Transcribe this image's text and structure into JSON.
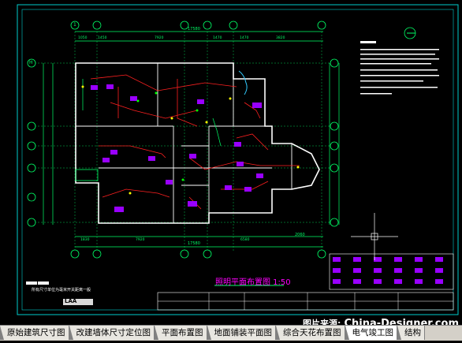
{
  "drawing": {
    "dims_top": [
      "17580"
    ],
    "dims_top_parts": [
      "1050",
      "1450",
      "7920",
      "1470",
      "1470",
      "3820"
    ],
    "dims_bottom": [
      "17580"
    ],
    "dims_bottom_parts": [
      "1830",
      "7920",
      "6580"
    ],
    "dim_right_extra": "2060",
    "grid_left": [
      "H",
      "G",
      "E",
      "D",
      "C",
      "B",
      "A"
    ],
    "grid_top": [
      "1",
      "2",
      "3",
      "4",
      "5",
      "6"
    ],
    "plan_title": "照明平面布置图 1:50",
    "note_text": "所有尺寸单位为毫米开关距离一般",
    "logo": "LAA"
  },
  "tabs": [
    {
      "label": "原始建筑尺寸图"
    },
    {
      "label": "改建墙体尺寸定位图"
    },
    {
      "label": "平面布置图"
    },
    {
      "label": "地面铺装平面图"
    },
    {
      "label": "综合天花布置图"
    },
    {
      "label": "电气竣工图"
    },
    {
      "label": "结构"
    }
  ],
  "watermark": {
    "prefix": "图片来源:",
    "site": "China-Designer.com"
  },
  "colors": {
    "wall": "#ffffff",
    "grid": "#00ff00",
    "wire": "#ff0000",
    "fixture": "#9900ff",
    "title": "#ff00ff",
    "dim": "#00ff66"
  }
}
